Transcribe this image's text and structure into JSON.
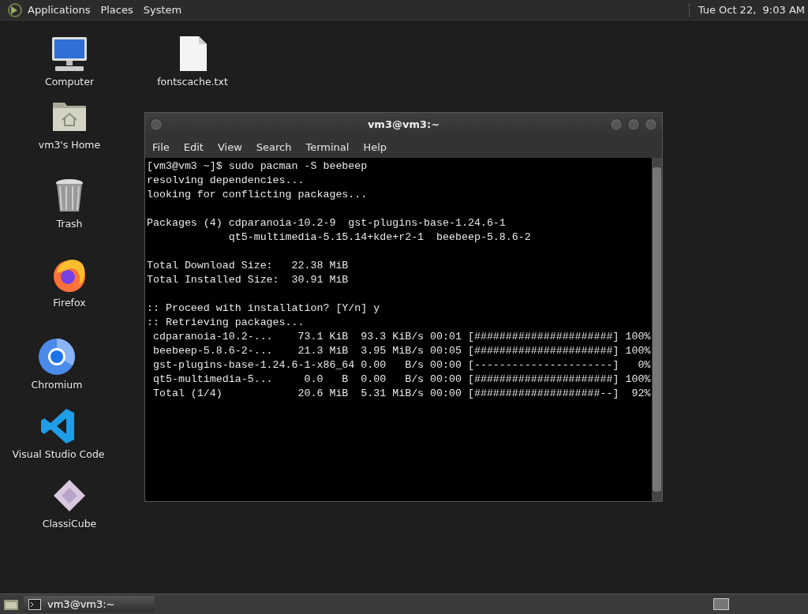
{
  "top_panel": {
    "menus": [
      "Applications",
      "Places",
      "System"
    ],
    "clock": "Tue Oct 22,  9:03 AM"
  },
  "desktop_icons": [
    {
      "kind": "computer",
      "label": "Computer"
    },
    {
      "kind": "file",
      "label": "fontscache.txt"
    },
    {
      "kind": "home",
      "label": "vm3's Home"
    },
    {
      "kind": "trash",
      "label": "Trash"
    },
    {
      "kind": "firefox",
      "label": "Firefox"
    },
    {
      "kind": "chromium",
      "label": "Chromium"
    },
    {
      "kind": "vscode",
      "label": "Visual Studio Code"
    },
    {
      "kind": "classicube",
      "label": "ClassiCube"
    }
  ],
  "terminal_window": {
    "title": "vm3@vm3:~",
    "menu": [
      "File",
      "Edit",
      "View",
      "Search",
      "Terminal",
      "Help"
    ],
    "output_blocks": [
      [
        "[vm3@vm3 ~]$ sudo pacman -S beebeep",
        "resolving dependencies...",
        "looking for conflicting packages..."
      ],
      [
        "Packages (4) cdparanoia-10.2-9  gst-plugins-base-1.24.6-1",
        "             qt5-multimedia-5.15.14+kde+r2-1  beebeep-5.8.6-2"
      ],
      [
        "Total Download Size:   22.38 MiB",
        "Total Installed Size:  30.91 MiB"
      ],
      [
        ":: Proceed with installation? [Y/n] y",
        ":: Retrieving packages...",
        " cdparanoia-10.2-...    73.1 KiB  93.3 KiB/s 00:01 [######################] 100%",
        " beebeep-5.8.6-2-...    21.3 MiB  3.95 MiB/s 00:05 [######################] 100%",
        " gst-plugins-base-1.24.6-1-x86_64 0.00   B/s 00:00 [----------------------]   0%",
        " qt5-multimedia-5...     0.0   B  0.00   B/s 00:00 [######################] 100%",
        " Total (1/4)            20.6 MiB  5.31 MiB/s 00:00 [####################--]  92%"
      ]
    ]
  },
  "taskbar": {
    "tasks": [
      {
        "title": "vm3@vm3:~",
        "selected": true
      }
    ]
  }
}
